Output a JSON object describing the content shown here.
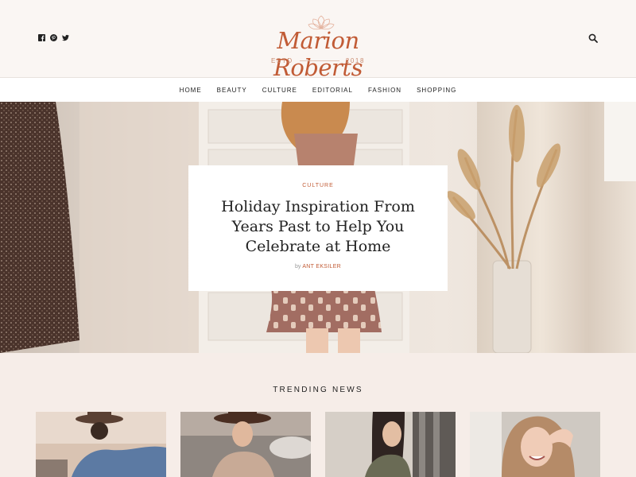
{
  "brand": {
    "name": "Marion Roberts",
    "estd_label": "ESTD",
    "year": "2018",
    "color": "#c15b35"
  },
  "social": [
    "facebook-icon",
    "pinterest-icon",
    "twitter-icon"
  ],
  "nav": {
    "items": [
      "HOME",
      "BEAUTY",
      "CULTURE",
      "EDITORIAL",
      "FASHION",
      "SHOPPING"
    ]
  },
  "hero": {
    "category": "CULTURE",
    "title": "Holiday Inspiration From Years Past to Help You Celebrate at Home",
    "by": "by",
    "author": "ANT EKSILER"
  },
  "trending": {
    "title": "TRENDING NEWS"
  }
}
